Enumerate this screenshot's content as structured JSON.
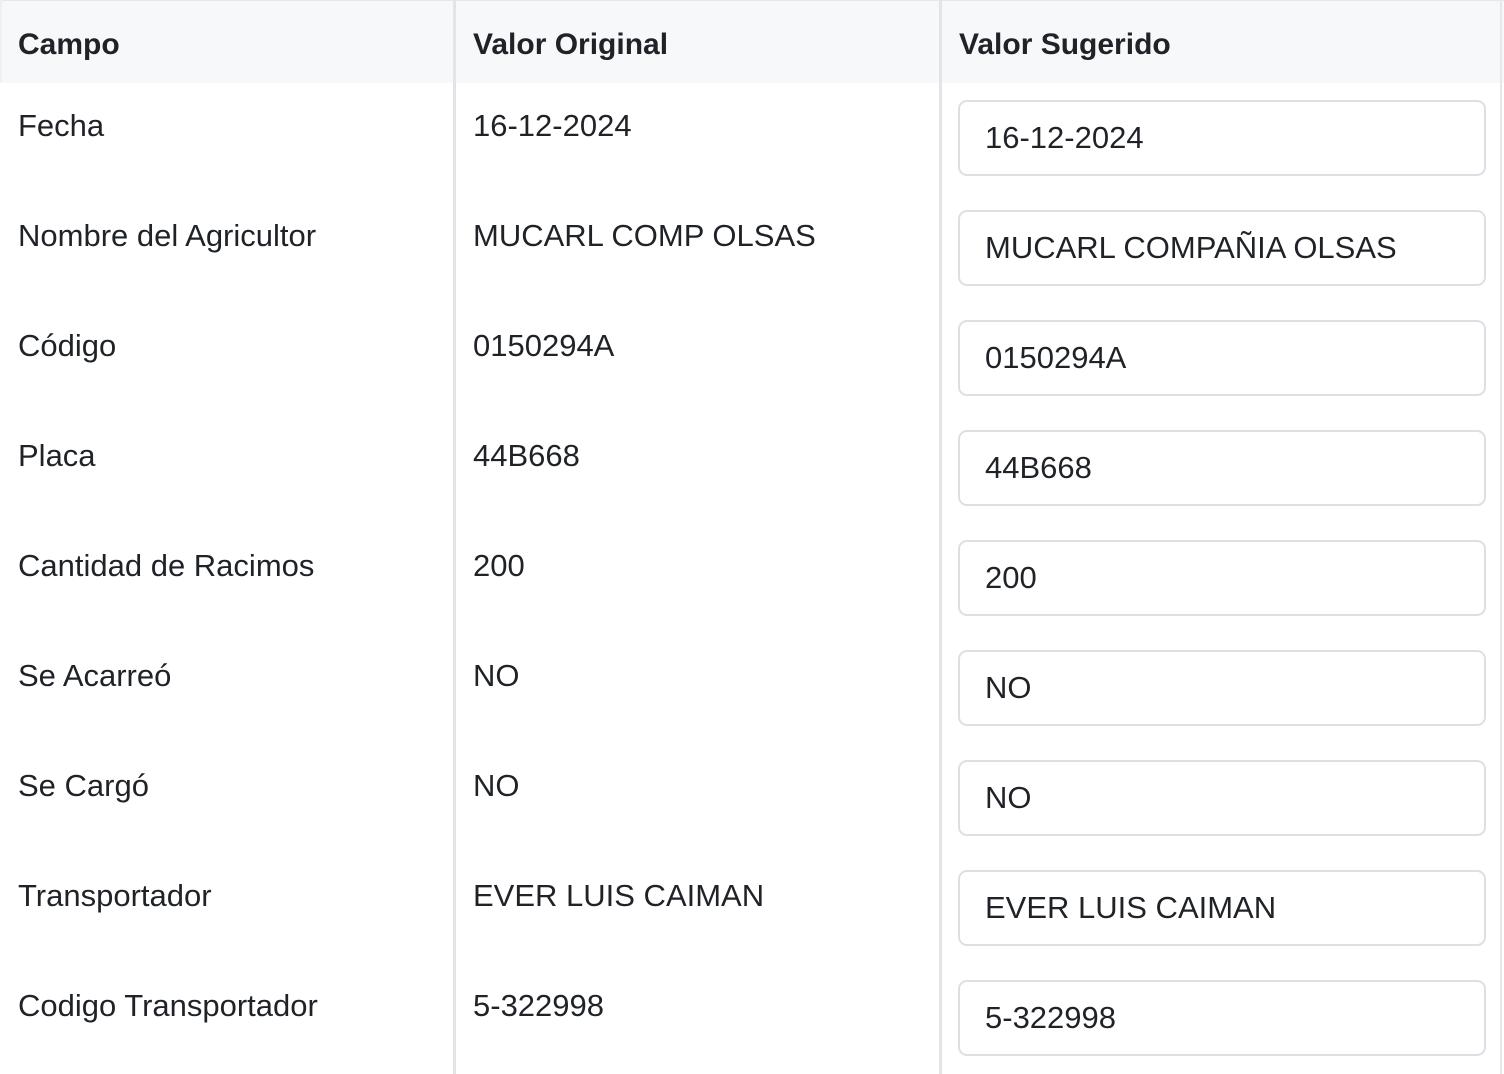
{
  "headers": {
    "field": "Campo",
    "original": "Valor Original",
    "suggested": "Valor Sugerido"
  },
  "rows": [
    {
      "field": "Fecha",
      "original": "16-12-2024",
      "suggested": "16-12-2024"
    },
    {
      "field": "Nombre del Agricultor",
      "original": "MUCARL COMP OLSAS",
      "suggested": "MUCARL COMPAÑIA OLSAS"
    },
    {
      "field": "Código",
      "original": "0150294A",
      "suggested": "0150294A"
    },
    {
      "field": "Placa",
      "original": "44B668",
      "suggested": "44B668"
    },
    {
      "field": "Cantidad de Racimos",
      "original": "200",
      "suggested": "200"
    },
    {
      "field": "Se Acarreó",
      "original": "NO",
      "suggested": "NO"
    },
    {
      "field": "Se Cargó",
      "original": "NO",
      "suggested": "NO"
    },
    {
      "field": "Transportador",
      "original": "EVER LUIS CAIMAN",
      "suggested": "EVER LUIS CAIMAN"
    },
    {
      "field": "Codigo Transportador",
      "original": "5-322998",
      "suggested": "5-322998"
    }
  ]
}
